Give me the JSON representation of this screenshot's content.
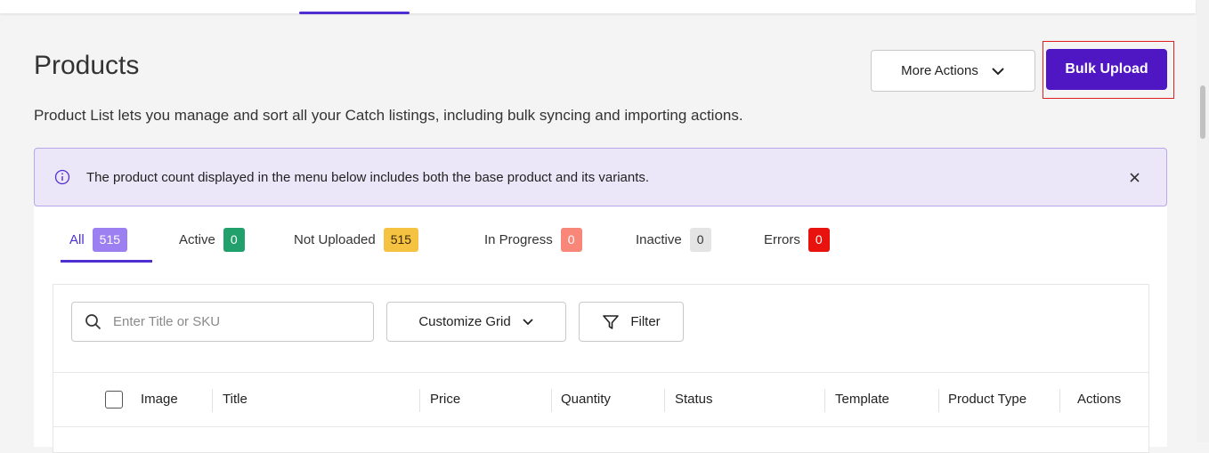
{
  "page": {
    "title": "Products",
    "subtitle": "Product List lets you manage and sort all your Catch listings, including bulk syncing and importing actions."
  },
  "header_actions": {
    "more_actions_label": "More Actions",
    "bulk_upload_label": "Bulk Upload"
  },
  "banner": {
    "text": "The product count displayed in the menu below includes both the base product and its variants.",
    "close_glyph": "×"
  },
  "tabs": [
    {
      "label": "All",
      "count": "515",
      "badge_bg": "#9c7ff0",
      "badge_fg": "#ffffff",
      "active": true
    },
    {
      "label": "Active",
      "count": "0",
      "badge_bg": "#22a06b",
      "badge_fg": "#ffffff",
      "active": false
    },
    {
      "label": "Not Uploaded",
      "count": "515",
      "badge_bg": "#f5c242",
      "badge_fg": "#3a2a00",
      "active": false
    },
    {
      "label": "In Progress",
      "count": "0",
      "badge_bg": "#f8877a",
      "badge_fg": "#ffffff",
      "active": false
    },
    {
      "label": "Inactive",
      "count": "0",
      "badge_bg": "#e4e4e4",
      "badge_fg": "#333333",
      "active": false
    },
    {
      "label": "Errors",
      "count": "0",
      "badge_bg": "#e8130f",
      "badge_fg": "#ffffff",
      "active": false
    }
  ],
  "toolbar": {
    "search_placeholder": "Enter Title or SKU",
    "customize_grid_label": "Customize Grid",
    "filter_label": "Filter"
  },
  "table": {
    "columns": [
      "Image",
      "Title",
      "Price",
      "Quantity",
      "Status",
      "Template",
      "Product Type",
      "Actions"
    ]
  },
  "colors": {
    "accent": "#4f2fd1",
    "primary_button": "#4f17c3",
    "highlight_border": "#e0201f",
    "banner_bg": "#ece7f8"
  }
}
